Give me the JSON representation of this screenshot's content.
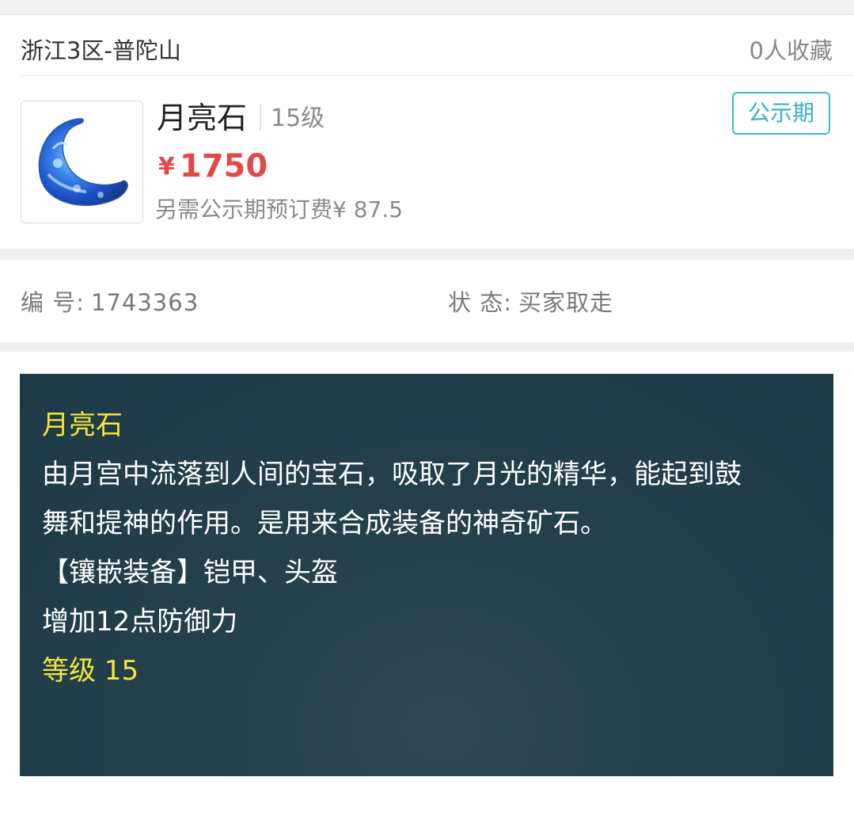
{
  "listing": {
    "server": "浙江3区-普陀山",
    "favorites": "0人收藏",
    "item_name": "月亮石",
    "item_level": "15级",
    "price_symbol": "¥",
    "price": "1750",
    "extra_fee": "另需公示期预订费¥ 87.5",
    "status_tag": "公示期",
    "thumbnail_icon": "moonstone-gem-icon"
  },
  "info": {
    "id_label": "编 号:",
    "id_value": "1743363",
    "state_label": "状 态:",
    "state_value": "买家取走"
  },
  "description": {
    "title": "月亮石",
    "line1": "由月宫中流落到人间的宝石，吸取了月光的精华，能起到鼓",
    "line2": "舞和提神的作用。是用来合成装备的神奇矿石。",
    "line3": "【镶嵌装备】铠甲、头盔",
    "line4": "增加12点防御力",
    "level": "等级 15"
  },
  "colors": {
    "price": "#e24a4a",
    "tag_border": "#3fb8d8",
    "panel_bg": "#23404b",
    "highlight_text": "#f5e63a"
  }
}
